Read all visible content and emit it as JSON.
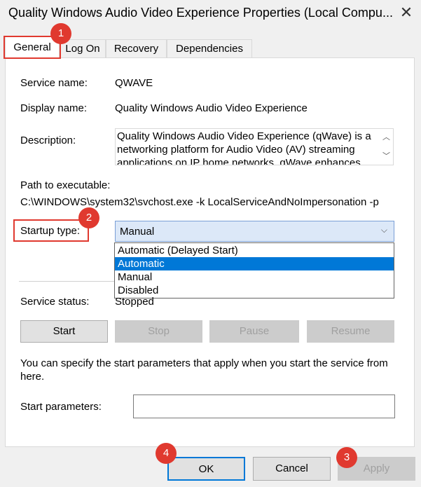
{
  "window": {
    "title": "Quality Windows Audio Video Experience Properties (Local Compu...",
    "close_icon": "close-icon"
  },
  "tabs": [
    {
      "label": "General",
      "active": true
    },
    {
      "label": "Log On",
      "active": false
    },
    {
      "label": "Recovery",
      "active": false
    },
    {
      "label": "Dependencies",
      "active": false
    }
  ],
  "general": {
    "service_name_label": "Service name:",
    "service_name": "QWAVE",
    "display_name_label": "Display name:",
    "display_name": "Quality Windows Audio Video Experience",
    "description_label": "Description:",
    "description": "Quality Windows Audio Video Experience (qWave) is a networking platform for Audio Video (AV) streaming applications on IP home networks. qWave enhances",
    "path_label": "Path to executable:",
    "path": "C:\\WINDOWS\\system32\\svchost.exe -k LocalServiceAndNoImpersonation -p",
    "startup_type_label": "Startup type:",
    "startup_type_value": "Manual",
    "startup_options": [
      "Automatic (Delayed Start)",
      "Automatic",
      "Manual",
      "Disabled"
    ],
    "highlighted_option": "Automatic",
    "service_status_label": "Service status:",
    "service_status": "Stopped",
    "buttons": {
      "start": "Start",
      "stop": "Stop",
      "pause": "Pause",
      "resume": "Resume"
    },
    "info_text": "You can specify the start parameters that apply when you start the service from here.",
    "start_params_label": "Start parameters:",
    "start_params_value": ""
  },
  "footer": {
    "ok": "OK",
    "cancel": "Cancel",
    "apply": "Apply"
  },
  "annotations": [
    {
      "number": "1"
    },
    {
      "number": "2"
    },
    {
      "number": "3"
    },
    {
      "number": "4"
    }
  ],
  "colors": {
    "annotation": "#e0392f",
    "selection": "#0078d7"
  }
}
